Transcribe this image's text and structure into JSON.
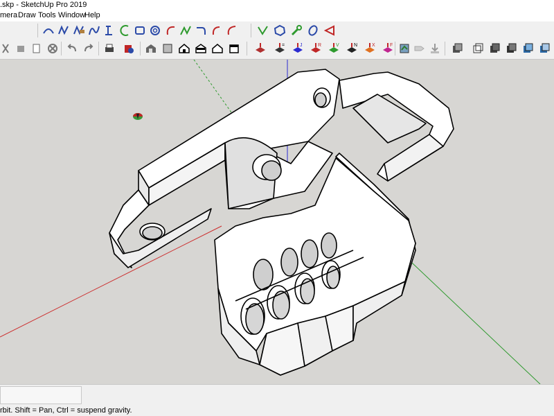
{
  "window": {
    "title": ".skp - SketchUp Pro 2019"
  },
  "menu": {
    "items": [
      "mera",
      "Draw",
      "Tools",
      "Window",
      "Help"
    ]
  },
  "toolbar": {
    "row1": [
      "arc-tool-icon",
      "freehand-tool-icon",
      "eraser-curve-icon",
      "bezier-tool-icon",
      "polyline-tool-icon",
      "arc-2pt-icon",
      "rectangle-icon",
      "spiral-icon",
      "arc-3pt-icon",
      "curve-icon",
      "arc-pie-icon",
      "arc-red-icon",
      "line-icon",
      "polygon-icon",
      "wrench-icon",
      "ellipse-icon",
      "cone-icon"
    ],
    "row2_left": [
      "scissors-icon",
      "stamp-icon",
      "page-icon",
      "cancel-icon",
      "undo-icon",
      "redo-icon",
      "print-icon",
      "model-info-icon"
    ],
    "views": [
      "iso-view-icon",
      "front-view-icon",
      "top-view-icon",
      "back-view-icon",
      "left-view-icon",
      "right-view-icon"
    ],
    "axis_tools": [
      "",
      "=",
      "J",
      "R",
      "V",
      "N",
      "X",
      "F"
    ],
    "styles": [
      "xray-icon",
      "back-edges-icon",
      "wireframe-icon",
      "hidden-line-icon",
      "shaded-icon",
      "shaded-texture-icon",
      "monochrome-icon"
    ]
  },
  "accent": {
    "red_axis": "#cc2b2b",
    "green_axis": "#2f9a2f",
    "blue_axis": "#2b2bd0"
  },
  "status": {
    "hint": "rbit. Shift = Pan, Ctrl = suspend gravity."
  }
}
